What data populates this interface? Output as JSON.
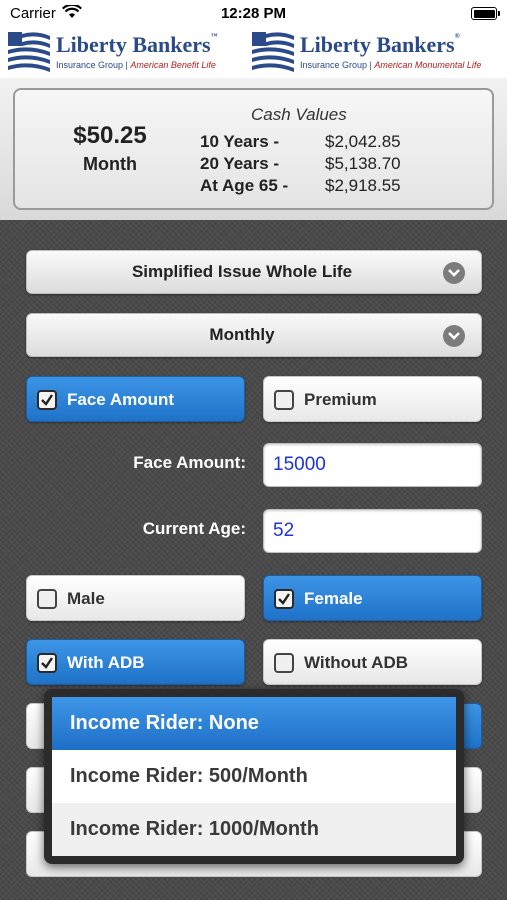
{
  "status_bar": {
    "carrier": "Carrier",
    "time": "12:28 PM"
  },
  "logos": [
    {
      "name": "Liberty Bankers",
      "tagline_left": "Insurance Group",
      "tagline_right": "American Benefit Life"
    },
    {
      "name": "Liberty Bankers",
      "tagline_left": "Insurance Group",
      "tagline_right": "American Monumental Life"
    }
  ],
  "summary": {
    "premium_amount": "$50.25",
    "premium_frequency": "Month",
    "cash_values_title": "Cash Values",
    "cash_values": [
      {
        "label": "10 Years -",
        "value": "$2,042.85"
      },
      {
        "label": "20 Years -",
        "value": "$5,138.70"
      },
      {
        "label": "At Age 65 -",
        "value": "$2,918.55"
      }
    ]
  },
  "product_select": {
    "value": "Simplified Issue Whole Life"
  },
  "mode_select": {
    "value": "Monthly"
  },
  "calc_by": {
    "face_amount": {
      "label": "Face Amount",
      "checked": true
    },
    "premium": {
      "label": "Premium",
      "checked": false
    }
  },
  "fields": {
    "face_amount": {
      "label": "Face Amount:",
      "value": "15000"
    },
    "current_age": {
      "label": "Current Age:",
      "value": "52"
    }
  },
  "gender": {
    "male": {
      "label": "Male",
      "checked": false
    },
    "female": {
      "label": "Female",
      "checked": true
    }
  },
  "adb": {
    "with": {
      "label": "With ADB",
      "checked": true
    },
    "without": {
      "label": "Without ADB",
      "checked": false
    }
  },
  "income_rider_menu": {
    "options": [
      {
        "label": "Income Rider: None",
        "selected": true
      },
      {
        "label": "Income Rider: 500/Month",
        "selected": false
      },
      {
        "label": "Income Rider: 1000/Month",
        "selected": false
      }
    ]
  },
  "colors": {
    "accent": "#2680d8",
    "input_text": "#1b35d6",
    "brand_blue": "#2a4a8a",
    "brand_red": "#b32020"
  }
}
